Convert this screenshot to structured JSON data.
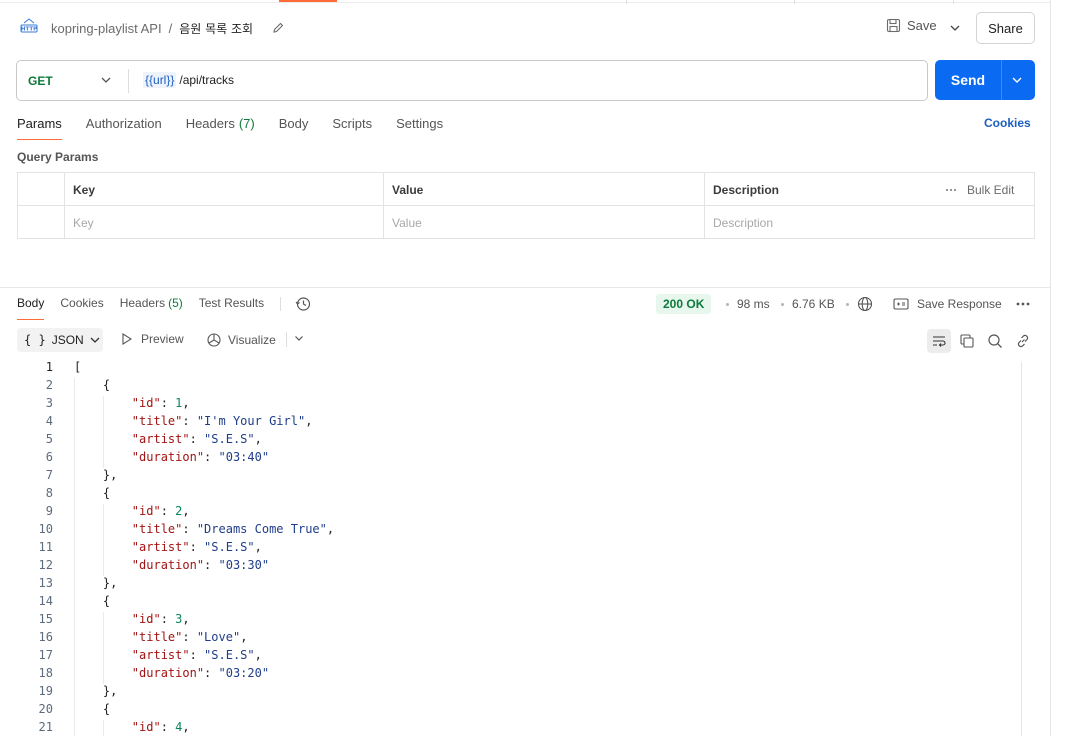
{
  "breadcrumb": {
    "collection": "kopring-playlist API",
    "separator": "/",
    "request": "음원 목록 조회"
  },
  "actions": {
    "save": "Save",
    "share": "Share"
  },
  "request": {
    "method": "GET",
    "url_variable": "{{url}}",
    "url_path": "/api/tracks",
    "send": "Send"
  },
  "request_tabs": [
    {
      "label": "Params",
      "count": ""
    },
    {
      "label": "Authorization",
      "count": ""
    },
    {
      "label": "Headers",
      "count": "(7)"
    },
    {
      "label": "Body",
      "count": ""
    },
    {
      "label": "Scripts",
      "count": ""
    },
    {
      "label": "Settings",
      "count": ""
    }
  ],
  "cookies_link": "Cookies",
  "query_params": {
    "title": "Query Params",
    "headers": [
      "Key",
      "Value",
      "Description"
    ],
    "placeholders": [
      "Key",
      "Value",
      "Description"
    ],
    "bulk_edit": "Bulk Edit"
  },
  "response_tabs": [
    {
      "label": "Body",
      "count": ""
    },
    {
      "label": "Cookies",
      "count": ""
    },
    {
      "label": "Headers",
      "count": "(5)"
    },
    {
      "label": "Test Results",
      "count": ""
    }
  ],
  "response_meta": {
    "status": "200 OK",
    "time": "98 ms",
    "size": "6.76 KB",
    "save_response": "Save Response"
  },
  "response_toolbar": {
    "format": "JSON",
    "preview": "Preview",
    "visualize": "Visualize"
  },
  "code_lines": [
    "[",
    "    {",
    "        \"id\": 1,",
    "        \"title\": \"I'm Your Girl\",",
    "        \"artist\": \"S.E.S\",",
    "        \"duration\": \"03:40\"",
    "    },",
    "    {",
    "        \"id\": 2,",
    "        \"title\": \"Dreams Come True\",",
    "        \"artist\": \"S.E.S\",",
    "        \"duration\": \"03:30\"",
    "    },",
    "    {",
    "        \"id\": 3,",
    "        \"title\": \"Love\",",
    "        \"artist\": \"S.E.S\",",
    "        \"duration\": \"03:20\"",
    "    },",
    "    {",
    "        \"id\": 4,"
  ],
  "colors": {
    "accent": "#0a6bf2",
    "tab_underline": "#ff6c37",
    "method_get": "#0d7a3c",
    "status_ok": "#0d7a3c"
  },
  "icons": [
    "http-icon",
    "edit-icon",
    "save-icon",
    "chevron-down-icon",
    "bulk-edit-icon",
    "history-icon",
    "globe-icon",
    "save-response-icon",
    "more-icon",
    "play-icon",
    "visualize-icon",
    "wrap-icon",
    "copy-icon",
    "search-icon",
    "link-icon"
  ]
}
